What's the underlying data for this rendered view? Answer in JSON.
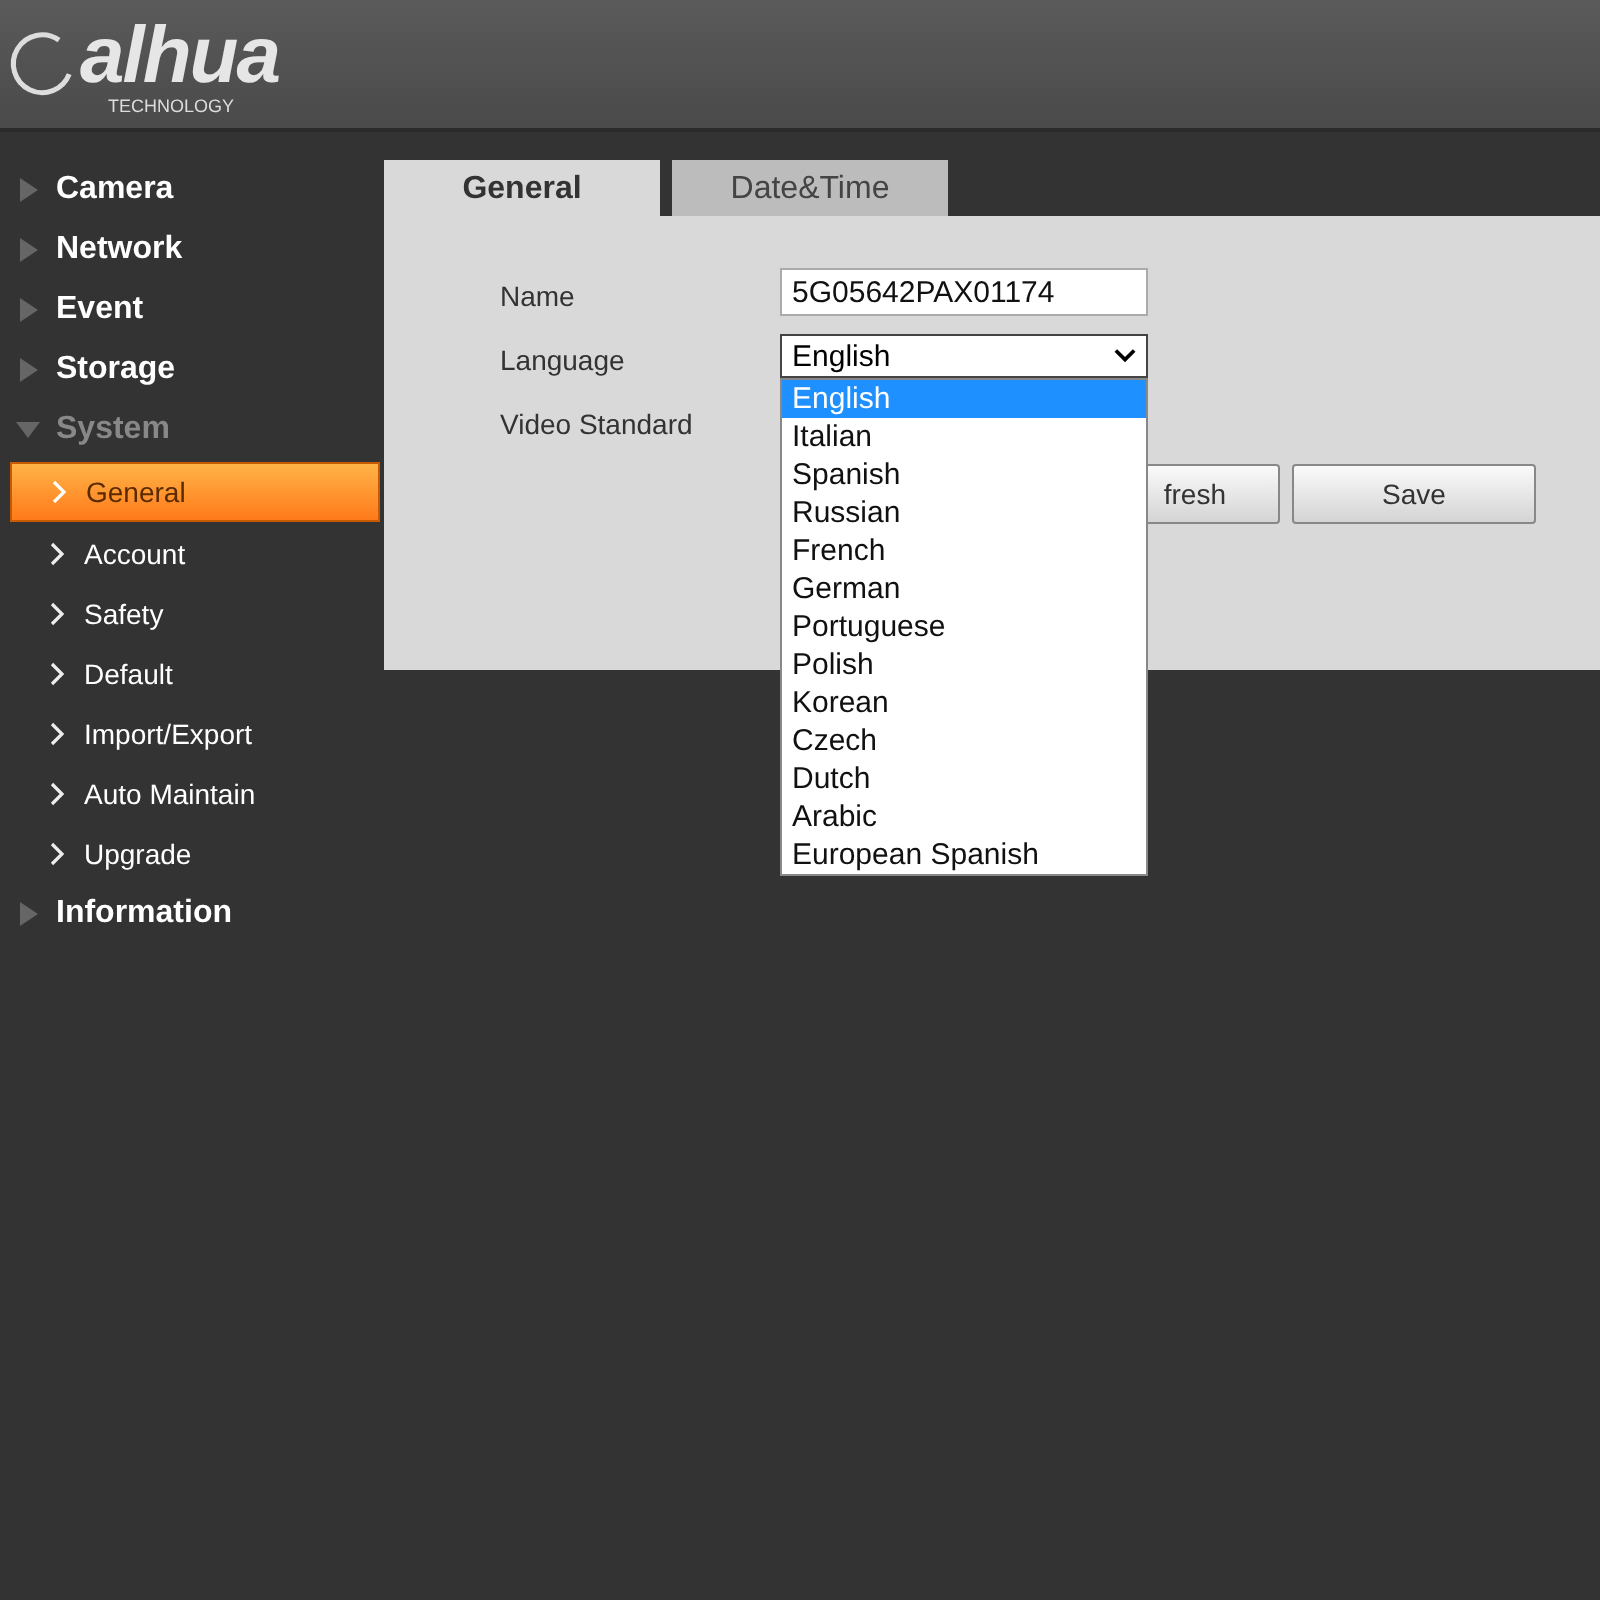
{
  "logo": {
    "brand": "alhua",
    "tagline": "TECHNOLOGY"
  },
  "sidebar": {
    "items": [
      {
        "label": "Camera",
        "expanded": false
      },
      {
        "label": "Network",
        "expanded": false
      },
      {
        "label": "Event",
        "expanded": false
      },
      {
        "label": "Storage",
        "expanded": false
      },
      {
        "label": "System",
        "expanded": true,
        "children": [
          {
            "label": "General",
            "selected": true
          },
          {
            "label": "Account",
            "selected": false
          },
          {
            "label": "Safety",
            "selected": false
          },
          {
            "label": "Default",
            "selected": false
          },
          {
            "label": "Import/Export",
            "selected": false
          },
          {
            "label": "Auto Maintain",
            "selected": false
          },
          {
            "label": "Upgrade",
            "selected": false
          }
        ]
      },
      {
        "label": "Information",
        "expanded": false
      }
    ]
  },
  "tabs": [
    {
      "label": "General",
      "selected": true
    },
    {
      "label": "Date&Time",
      "selected": false
    }
  ],
  "form": {
    "fields": [
      {
        "kind": "text",
        "label": "Name",
        "value": "5G05642PAX01174"
      },
      {
        "kind": "select",
        "label": "Language",
        "value": "English",
        "open": true,
        "options": [
          {
            "label": "English",
            "selected": true
          },
          {
            "label": "Italian",
            "selected": false
          },
          {
            "label": "Spanish",
            "selected": false
          },
          {
            "label": "Russian",
            "selected": false
          },
          {
            "label": "French",
            "selected": false
          },
          {
            "label": "German",
            "selected": false
          },
          {
            "label": "Portuguese",
            "selected": false
          },
          {
            "label": "Polish",
            "selected": false
          },
          {
            "label": "Korean",
            "selected": false
          },
          {
            "label": "Czech",
            "selected": false
          },
          {
            "label": "Dutch",
            "selected": false
          },
          {
            "label": "Arabic",
            "selected": false
          },
          {
            "label": "European Spanish",
            "selected": false
          }
        ]
      },
      {
        "kind": "covered",
        "label": "Video Standard"
      }
    ]
  },
  "buttons": [
    {
      "kind": "refresh",
      "label": "fresh"
    },
    {
      "kind": "save",
      "label": "Save"
    }
  ]
}
